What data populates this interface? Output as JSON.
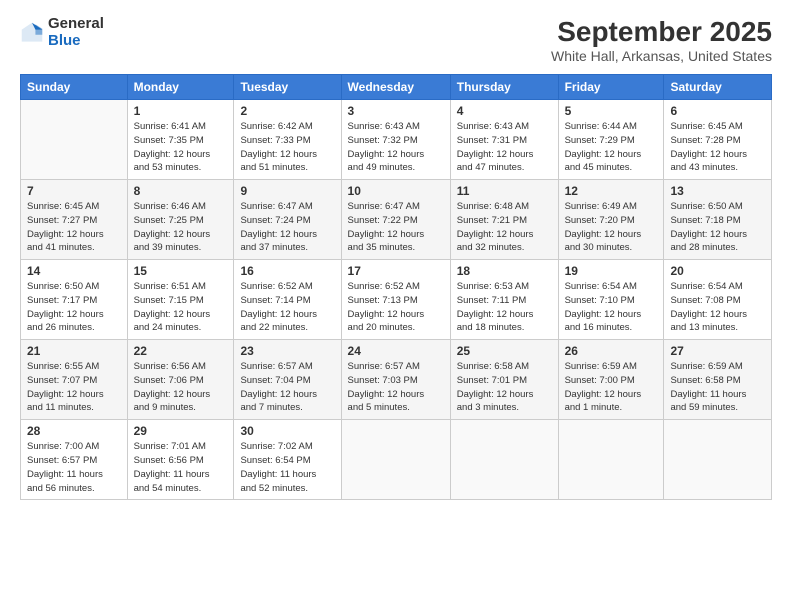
{
  "logo": {
    "general": "General",
    "blue": "Blue"
  },
  "title": "September 2025",
  "subtitle": "White Hall, Arkansas, United States",
  "days_of_week": [
    "Sunday",
    "Monday",
    "Tuesday",
    "Wednesday",
    "Thursday",
    "Friday",
    "Saturday"
  ],
  "weeks": [
    [
      {
        "day": "",
        "info": ""
      },
      {
        "day": "1",
        "info": "Sunrise: 6:41 AM\nSunset: 7:35 PM\nDaylight: 12 hours\nand 53 minutes."
      },
      {
        "day": "2",
        "info": "Sunrise: 6:42 AM\nSunset: 7:33 PM\nDaylight: 12 hours\nand 51 minutes."
      },
      {
        "day": "3",
        "info": "Sunrise: 6:43 AM\nSunset: 7:32 PM\nDaylight: 12 hours\nand 49 minutes."
      },
      {
        "day": "4",
        "info": "Sunrise: 6:43 AM\nSunset: 7:31 PM\nDaylight: 12 hours\nand 47 minutes."
      },
      {
        "day": "5",
        "info": "Sunrise: 6:44 AM\nSunset: 7:29 PM\nDaylight: 12 hours\nand 45 minutes."
      },
      {
        "day": "6",
        "info": "Sunrise: 6:45 AM\nSunset: 7:28 PM\nDaylight: 12 hours\nand 43 minutes."
      }
    ],
    [
      {
        "day": "7",
        "info": "Sunrise: 6:45 AM\nSunset: 7:27 PM\nDaylight: 12 hours\nand 41 minutes."
      },
      {
        "day": "8",
        "info": "Sunrise: 6:46 AM\nSunset: 7:25 PM\nDaylight: 12 hours\nand 39 minutes."
      },
      {
        "day": "9",
        "info": "Sunrise: 6:47 AM\nSunset: 7:24 PM\nDaylight: 12 hours\nand 37 minutes."
      },
      {
        "day": "10",
        "info": "Sunrise: 6:47 AM\nSunset: 7:22 PM\nDaylight: 12 hours\nand 35 minutes."
      },
      {
        "day": "11",
        "info": "Sunrise: 6:48 AM\nSunset: 7:21 PM\nDaylight: 12 hours\nand 32 minutes."
      },
      {
        "day": "12",
        "info": "Sunrise: 6:49 AM\nSunset: 7:20 PM\nDaylight: 12 hours\nand 30 minutes."
      },
      {
        "day": "13",
        "info": "Sunrise: 6:50 AM\nSunset: 7:18 PM\nDaylight: 12 hours\nand 28 minutes."
      }
    ],
    [
      {
        "day": "14",
        "info": "Sunrise: 6:50 AM\nSunset: 7:17 PM\nDaylight: 12 hours\nand 26 minutes."
      },
      {
        "day": "15",
        "info": "Sunrise: 6:51 AM\nSunset: 7:15 PM\nDaylight: 12 hours\nand 24 minutes."
      },
      {
        "day": "16",
        "info": "Sunrise: 6:52 AM\nSunset: 7:14 PM\nDaylight: 12 hours\nand 22 minutes."
      },
      {
        "day": "17",
        "info": "Sunrise: 6:52 AM\nSunset: 7:13 PM\nDaylight: 12 hours\nand 20 minutes."
      },
      {
        "day": "18",
        "info": "Sunrise: 6:53 AM\nSunset: 7:11 PM\nDaylight: 12 hours\nand 18 minutes."
      },
      {
        "day": "19",
        "info": "Sunrise: 6:54 AM\nSunset: 7:10 PM\nDaylight: 12 hours\nand 16 minutes."
      },
      {
        "day": "20",
        "info": "Sunrise: 6:54 AM\nSunset: 7:08 PM\nDaylight: 12 hours\nand 13 minutes."
      }
    ],
    [
      {
        "day": "21",
        "info": "Sunrise: 6:55 AM\nSunset: 7:07 PM\nDaylight: 12 hours\nand 11 minutes."
      },
      {
        "day": "22",
        "info": "Sunrise: 6:56 AM\nSunset: 7:06 PM\nDaylight: 12 hours\nand 9 minutes."
      },
      {
        "day": "23",
        "info": "Sunrise: 6:57 AM\nSunset: 7:04 PM\nDaylight: 12 hours\nand 7 minutes."
      },
      {
        "day": "24",
        "info": "Sunrise: 6:57 AM\nSunset: 7:03 PM\nDaylight: 12 hours\nand 5 minutes."
      },
      {
        "day": "25",
        "info": "Sunrise: 6:58 AM\nSunset: 7:01 PM\nDaylight: 12 hours\nand 3 minutes."
      },
      {
        "day": "26",
        "info": "Sunrise: 6:59 AM\nSunset: 7:00 PM\nDaylight: 12 hours\nand 1 minute."
      },
      {
        "day": "27",
        "info": "Sunrise: 6:59 AM\nSunset: 6:58 PM\nDaylight: 11 hours\nand 59 minutes."
      }
    ],
    [
      {
        "day": "28",
        "info": "Sunrise: 7:00 AM\nSunset: 6:57 PM\nDaylight: 11 hours\nand 56 minutes."
      },
      {
        "day": "29",
        "info": "Sunrise: 7:01 AM\nSunset: 6:56 PM\nDaylight: 11 hours\nand 54 minutes."
      },
      {
        "day": "30",
        "info": "Sunrise: 7:02 AM\nSunset: 6:54 PM\nDaylight: 11 hours\nand 52 minutes."
      },
      {
        "day": "",
        "info": ""
      },
      {
        "day": "",
        "info": ""
      },
      {
        "day": "",
        "info": ""
      },
      {
        "day": "",
        "info": ""
      }
    ]
  ]
}
